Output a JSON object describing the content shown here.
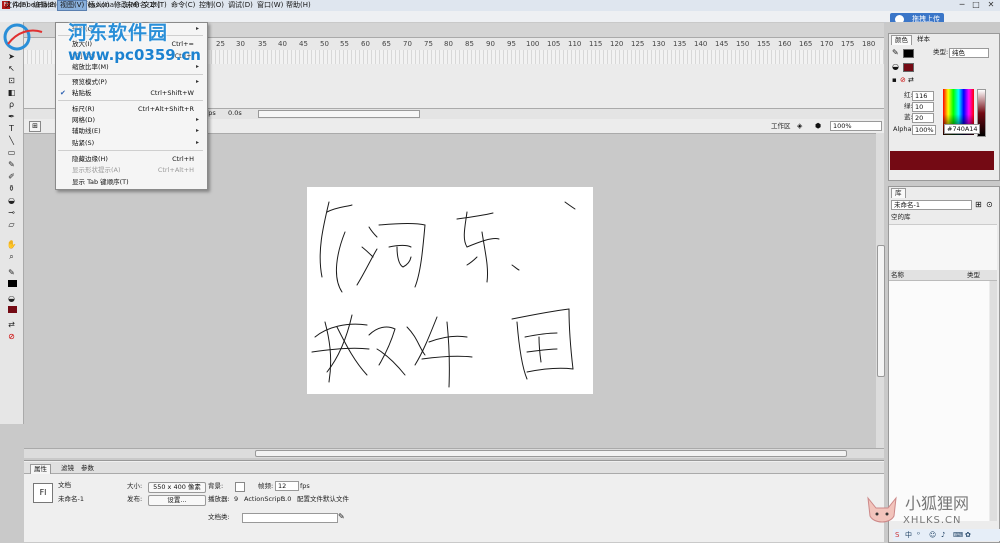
{
  "window": {
    "title": "Adobe Flash CS3 Professional - [未命名-1*]",
    "app_icon": "Fl",
    "controls": [
      "─",
      "□",
      "✕"
    ]
  },
  "menubar": {
    "items": [
      "文件(F)",
      "编辑(E)",
      "视图(V)",
      "插入(I)",
      "修改(M)",
      "文本(T)",
      "命令(C)",
      "控制(O)",
      "调试(D)",
      "窗口(W)",
      "帮助(H)"
    ],
    "active_index": 2
  },
  "upload_button": {
    "label": "拖拽上传"
  },
  "view_menu": {
    "items": [
      {
        "label": "转到(G)",
        "shortcut": "",
        "submenu": true,
        "disabled": false
      },
      {
        "label": "放大(I)",
        "shortcut": "Ctrl+=",
        "submenu": false,
        "disabled": false
      },
      {
        "label": "缩小(O)",
        "shortcut": "Ctrl+-",
        "submenu": false,
        "disabled": false
      },
      {
        "label": "缩放比率(M)",
        "shortcut": "",
        "submenu": true,
        "disabled": false
      },
      {
        "label": "预览模式(P)",
        "shortcut": "",
        "submenu": true,
        "disabled": false
      },
      {
        "label": "粘贴板",
        "shortcut": "Ctrl+Shift+W",
        "submenu": false,
        "disabled": false,
        "checked": true
      },
      {
        "label": "标尺(R)",
        "shortcut": "Ctrl+Alt+Shift+R",
        "submenu": false,
        "disabled": false
      },
      {
        "label": "网格(D)",
        "shortcut": "",
        "submenu": true,
        "disabled": false
      },
      {
        "label": "辅助线(E)",
        "shortcut": "",
        "submenu": true,
        "disabled": false
      },
      {
        "label": "贴紧(S)",
        "shortcut": "",
        "submenu": true,
        "disabled": false
      },
      {
        "label": "隐藏边缘(H)",
        "shortcut": "Ctrl+H",
        "submenu": false,
        "disabled": false
      },
      {
        "label": "显示形状提示(A)",
        "shortcut": "Ctrl+Alt+H",
        "submenu": false,
        "disabled": true
      },
      {
        "label": "显示 Tab 键顺序(T)",
        "shortcut": "",
        "submenu": false,
        "disabled": false
      }
    ],
    "check_mark": "✔",
    "submenu_arrow": "▸"
  },
  "ruler": {
    "ticks": [
      "25",
      "30",
      "35",
      "40",
      "45",
      "50",
      "55",
      "60",
      "65",
      "70",
      "75",
      "80",
      "85",
      "90",
      "95",
      "100",
      "105",
      "110",
      "115",
      "120",
      "125",
      "130",
      "135",
      "140",
      "145",
      "150",
      "155",
      "160",
      "165",
      "170",
      "175",
      "180"
    ]
  },
  "timeline_footer": {
    "fps_label": "fps",
    "time": "0.0s"
  },
  "edit_bar": {
    "workspace_label": "工作区",
    "zoom": "100%"
  },
  "watermark": {
    "site_name": "河东软件园",
    "url": "www.pc0359.cn",
    "corner_name": "小狐狸网",
    "corner_url": "XHLKS.CN"
  },
  "properties": {
    "tabs": [
      "属性",
      "滤镜",
      "参数"
    ],
    "active_tab": 0,
    "doc_label": "文档",
    "doc_name": "未命名-1",
    "size_label": "大小:",
    "size_value": "550 x 400 像素",
    "bg_label": "背景:",
    "fps_label": "帧频:",
    "fps_value": "12",
    "fps_unit": "fps",
    "publish_label": "发布:",
    "settings_button": "设置...",
    "player_label": "播放器:",
    "player_value": "9",
    "as_label": "ActionScript:",
    "as_value": "3.0",
    "profile_label": "配置文件:",
    "profile_value": "默认文件",
    "doc_class_label": "文档类:",
    "fl_icon": "Fl"
  },
  "color_panel": {
    "tabs": [
      "颜色",
      "样本"
    ],
    "type_label": "类型:",
    "type_value": "纯色",
    "red_label": "红:",
    "red_value": "116",
    "green_label": "绿:",
    "green_value": "10",
    "blue_label": "蓝:",
    "blue_value": "20",
    "alpha_label": "Alpha:",
    "alpha_value": "100%",
    "hex_value": "#740A14",
    "colors": {
      "fill": "#740a14",
      "stroke": "#000000"
    }
  },
  "library_panel": {
    "tabs": [
      "库"
    ],
    "doc_select": "未命名-1",
    "empty_label": "空的库",
    "col_name": "名称",
    "col_type": "类型"
  }
}
